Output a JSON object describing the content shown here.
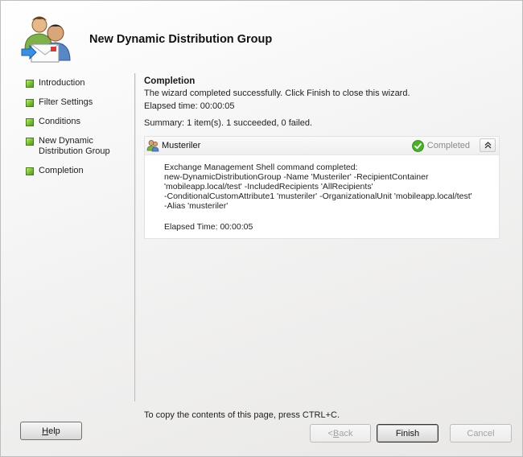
{
  "wizard": {
    "title": "New Dynamic Distribution Group"
  },
  "nav": {
    "items": [
      {
        "label": "Introduction"
      },
      {
        "label": "Filter Settings"
      },
      {
        "label": "Conditions"
      },
      {
        "label": "New Dynamic Distribution Group"
      },
      {
        "label": "Completion"
      }
    ]
  },
  "content": {
    "section_title": "Completion",
    "message": "The wizard completed successfully. Click Finish to close this wizard.",
    "elapsed": "Elapsed time: 00:00:05",
    "summary": "Summary: 1 item(s). 1 succeeded, 0 failed."
  },
  "result": {
    "name": "Musteriler",
    "status": "Completed",
    "icon": "green-check-icon",
    "heading": "Exchange Management Shell command completed:",
    "command_lines": [
      "new-DynamicDistributionGroup -Name 'Musteriler' -RecipientContainer",
      "'mobileapp.local/test' -IncludedRecipients 'AllRecipients'",
      "-ConditionalCustomAttribute1 'musteriler' -OrganizationalUnit 'mobileapp.local/test'",
      "-Alias 'musteriler'"
    ],
    "elapsed": "Elapsed Time: 00:00:05"
  },
  "footer": {
    "copy_hint": "To copy the contents of this page, press CTRL+C."
  },
  "buttons": {
    "help": {
      "pre": "",
      "key": "H",
      "post": "elp"
    },
    "back": {
      "pre": "< ",
      "key": "B",
      "post": "ack"
    },
    "finish": "Finish",
    "cancel": "Cancel"
  },
  "colors": {
    "bullet_green": "#7cc23a",
    "status_text": "#8a8a8a",
    "disabled_text": "#a2a2a2"
  }
}
